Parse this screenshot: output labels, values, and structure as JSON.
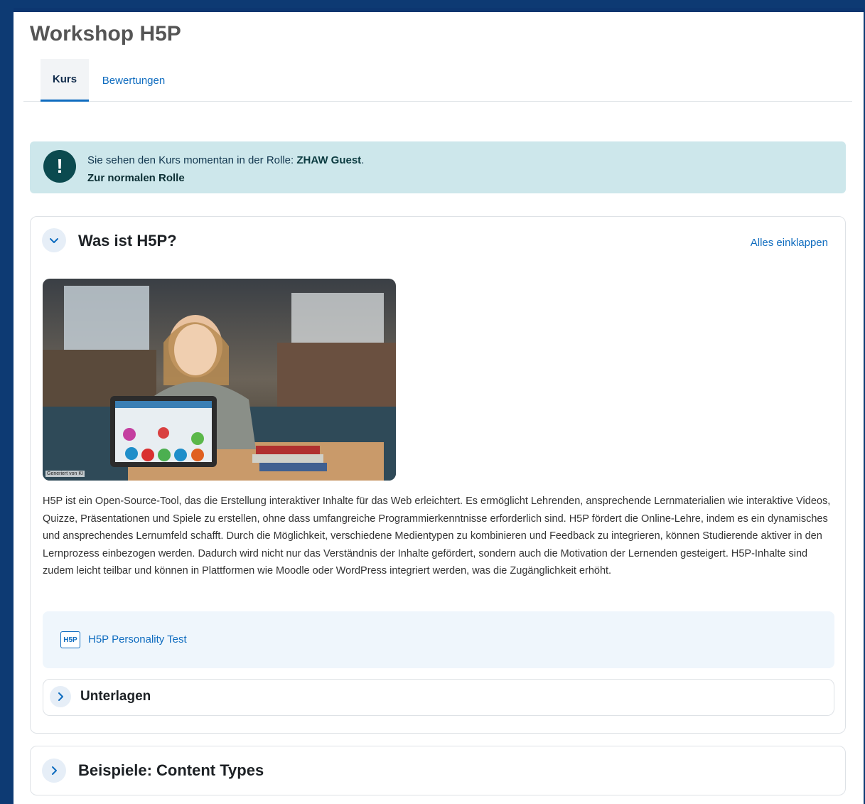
{
  "page": {
    "title": "Workshop H5P"
  },
  "tabs": [
    {
      "label": "Kurs"
    },
    {
      "label": "Bewertungen"
    }
  ],
  "alert": {
    "icon": "exclamation-icon",
    "text_prefix": "Sie sehen den Kurs momentan in der Rolle: ",
    "role": "ZHAW Guest",
    "text_suffix": ".",
    "link": "Zur normalen Rolle"
  },
  "sections": {
    "what_is": {
      "title": "Was ist H5P?",
      "collapse_all": "Alles einklappen",
      "image_caption": "Generiert von KI",
      "description": "H5P ist ein Open-Source-Tool, das die Erstellung interaktiver Inhalte für das Web erleichtert. Es ermöglicht Lehrenden, ansprechende Lernmaterialien wie interaktive Videos, Quizze, Präsentationen und Spiele zu erstellen, ohne dass umfangreiche Programmierkenntnisse erforderlich sind. H5P fördert die Online-Lehre, indem es ein dynamisches und ansprechendes Lernumfeld schafft. Durch die Möglichkeit, verschiedene Medientypen zu kombinieren und Feedback zu integrieren, können Studierende aktiver in den Lernprozess einbezogen werden. Dadurch wird nicht nur das Verständnis der Inhalte gefördert, sondern auch die Motivation der Lernenden gesteigert. H5P-Inhalte sind zudem leicht teilbar und können in Plattformen wie Moodle oder WordPress integriert werden, was die Zugänglichkeit erhöht.",
      "activity": {
        "icon_text": "H5P",
        "label": "H5P Personality Test"
      },
      "subsection": {
        "title": "Unterlagen"
      }
    },
    "examples": {
      "title": "Beispiele: Content Types"
    }
  }
}
